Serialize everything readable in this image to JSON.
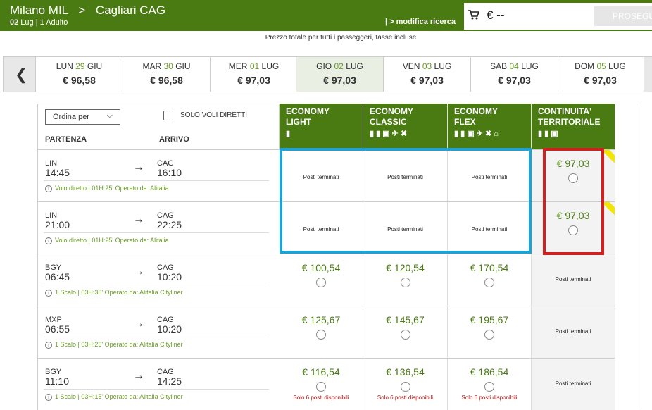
{
  "header": {
    "origin": "Milano MIL",
    "destination": "Cagliari CAG",
    "date_bold": "02",
    "date_rest": " Lug | 1 Adulto",
    "modify_link": "| > modifica ricerca",
    "total_price": "€ --",
    "continue_button": "PROSEGUI",
    "icons": [
      "cart-icon",
      "chevron-right-icon"
    ]
  },
  "note": "Prezzo totale per tutti i passeggeri, tasse incluse",
  "date_nav": {
    "prev_icon": "chevron-left-icon",
    "prev_glyph": "❮",
    "days": [
      {
        "day": "LUN",
        "num": "29",
        "month": "GIU",
        "price": "€ 96,58",
        "selected": false
      },
      {
        "day": "MAR",
        "num": "30",
        "month": "GIU",
        "price": "€ 96,58",
        "selected": false
      },
      {
        "day": "MER",
        "num": "01",
        "month": "LUG",
        "price": "€ 97,03",
        "selected": false
      },
      {
        "day": "GIO",
        "num": "02",
        "month": "LUG",
        "price": "€ 97,03",
        "selected": true
      },
      {
        "day": "VEN",
        "num": "03",
        "month": "LUG",
        "price": "€ 97,03",
        "selected": false
      },
      {
        "day": "SAB",
        "num": "04",
        "month": "LUG",
        "price": "€ 97,03",
        "selected": false
      },
      {
        "day": "DOM",
        "num": "05",
        "month": "LUG",
        "price": "€ 97,03",
        "selected": false
      }
    ]
  },
  "filters": {
    "sort_label": "Ordina per",
    "direct_only_label": "SOLO VOLI DIRETTI",
    "col_departure": "PARTENZA",
    "col_arrival": "ARRIVO"
  },
  "fares": [
    {
      "line1": "ECONOMY",
      "line2": "LIGHT",
      "icons": "▮"
    },
    {
      "line1": "ECONOMY",
      "line2": "CLASSIC",
      "icons": "▮ ▮ ▣ ✈ ✖"
    },
    {
      "line1": "ECONOMY",
      "line2": "FLEX",
      "icons": "▮ ▮ ▣ ✈ ✖ ⌂"
    },
    {
      "line1": "CONTINUITA'",
      "line2": "TERRITORIALE",
      "icons": "▮ ▮ ▣"
    }
  ],
  "flights": [
    {
      "dep_code": "LIN",
      "dep_time": "14:45",
      "arr_code": "CAG",
      "arr_time": "16:10",
      "info": "Volo diretto | 01H:25' Operato da: Alitalia",
      "cells": [
        {
          "type": "sold",
          "text": "Posti terminati"
        },
        {
          "type": "sold",
          "text": "Posti terminati"
        },
        {
          "type": "sold",
          "text": "Posti terminati"
        },
        {
          "type": "price",
          "text": "€ 97,03"
        }
      ]
    },
    {
      "dep_code": "LIN",
      "dep_time": "21:00",
      "arr_code": "CAG",
      "arr_time": "22:25",
      "info": "Volo diretto | 01H:25' Operato da: Alitalia",
      "cells": [
        {
          "type": "sold",
          "text": "Posti terminati"
        },
        {
          "type": "sold",
          "text": "Posti terminati"
        },
        {
          "type": "sold",
          "text": "Posti terminati"
        },
        {
          "type": "price",
          "text": "€ 97,03"
        }
      ]
    },
    {
      "dep_code": "BGY",
      "dep_time": "06:45",
      "arr_code": "CAG",
      "arr_time": "10:20",
      "info": "1 Scalo | 03H:35' Operato da: Alitalia Cityliner",
      "cells": [
        {
          "type": "price",
          "text": "€ 100,54"
        },
        {
          "type": "price",
          "text": "€ 120,54"
        },
        {
          "type": "price",
          "text": "€ 170,54"
        },
        {
          "type": "sold",
          "text": "Posti terminati"
        }
      ]
    },
    {
      "dep_code": "MXP",
      "dep_time": "06:55",
      "arr_code": "CAG",
      "arr_time": "10:20",
      "info": "1 Scalo | 03H:25' Operato da: Alitalia Cityliner",
      "cells": [
        {
          "type": "price",
          "text": "€ 125,67"
        },
        {
          "type": "price",
          "text": "€ 145,67"
        },
        {
          "type": "price",
          "text": "€ 195,67"
        },
        {
          "type": "sold",
          "text": "Posti terminati"
        }
      ]
    },
    {
      "dep_code": "BGY",
      "dep_time": "11:10",
      "arr_code": "CAG",
      "arr_time": "14:25",
      "info": "1 Scalo | 03H:15' Operato da: Alitalia Cityliner",
      "cells": [
        {
          "type": "price",
          "text": "€ 116,54",
          "warn": "Solo 6 posti disponibili"
        },
        {
          "type": "price",
          "text": "€ 136,54",
          "warn": "Solo 6 posti disponibili"
        },
        {
          "type": "price",
          "text": "€ 186,54",
          "warn": "Solo 6 posti disponibili"
        },
        {
          "type": "sold",
          "text": "Posti terminati"
        }
      ]
    }
  ],
  "colors": {
    "brand_green": "#4a7a12",
    "highlight_blue": "#1ea2d6",
    "highlight_red": "#d21f1f",
    "ribbon_yellow": "#f2e600"
  }
}
